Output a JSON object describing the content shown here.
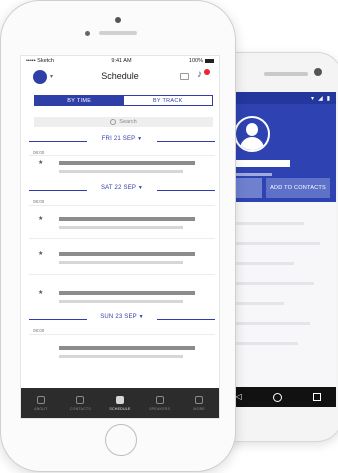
{
  "android": {
    "action_button": "ADD TO CONTACTS"
  },
  "iphone": {
    "status": {
      "carrier": "••••• Sketch",
      "time": "9:41 AM",
      "battery": "100%"
    },
    "title": "Schedule",
    "tabs": {
      "by_time": "BY TIME",
      "by_track": "BY TRACK"
    },
    "search_placeholder": "Search",
    "days": [
      {
        "label": "FRI 21 SEP",
        "time": "08:00"
      },
      {
        "label": "SAT 22 SEP",
        "time": "08:00"
      },
      {
        "label": "SUN 23 SEP",
        "time": "08:00"
      }
    ],
    "tabbar": [
      {
        "label": "ABOUT",
        "active": false
      },
      {
        "label": "CONTACTS",
        "active": false
      },
      {
        "label": "SCHEDULE",
        "active": true
      },
      {
        "label": "SPEAKERS",
        "active": false
      },
      {
        "label": "MORE",
        "active": false
      }
    ]
  },
  "colors": {
    "brand_blue": "#2e3fa8",
    "android_blue": "#2e43b1",
    "badge_red": "#e8262f",
    "tabbar_dark": "#2c2c2c"
  },
  "icons": {
    "schedule_star": "star-icon",
    "notification": "bell-icon",
    "messages": "chat-icon",
    "search": "search-icon"
  }
}
